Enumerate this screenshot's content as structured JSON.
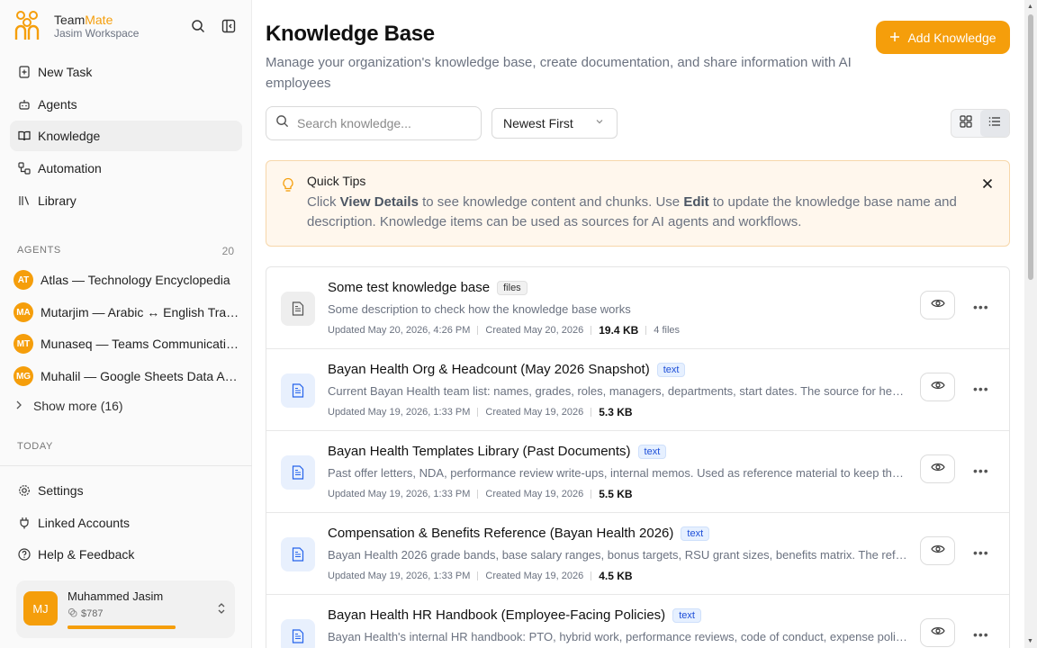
{
  "brand": {
    "name_part1": "Team",
    "name_part2": "Mate",
    "workspace": "Jasim Workspace"
  },
  "nav": [
    {
      "label": "New Task"
    },
    {
      "label": "Agents"
    },
    {
      "label": "Knowledge"
    },
    {
      "label": "Automation"
    },
    {
      "label": "Library"
    }
  ],
  "agents_section": {
    "label": "AGENTS",
    "count": "20"
  },
  "agents": [
    {
      "initials": "AT",
      "name": "Atlas — Technology Encyclopedia"
    },
    {
      "initials": "MA",
      "name": "Mutarjim — Arabic ↔ English Translator"
    },
    {
      "initials": "MT",
      "name": "Munaseq — Teams Communications"
    },
    {
      "initials": "MG",
      "name": "Muhalil — Google Sheets Data Analyst"
    }
  ],
  "show_more": "Show more (16)",
  "today_label": "TODAY",
  "bottom_nav": [
    {
      "label": "Settings"
    },
    {
      "label": "Linked Accounts"
    },
    {
      "label": "Help & Feedback"
    }
  ],
  "user": {
    "initials": "MJ",
    "name": "Muhammed Jasim",
    "credit": "$787",
    "credit_fraction": 1.0
  },
  "page": {
    "title": "Knowledge Base",
    "subtitle": "Manage your organization's knowledge base, create documentation, and share information with AI employees",
    "add_button": "Add Knowledge"
  },
  "search": {
    "placeholder": "Search knowledge..."
  },
  "sort": {
    "selected": "Newest First"
  },
  "tips": {
    "title": "Quick Tips",
    "part1": "Click ",
    "view_details": "View Details",
    "part2": " to see knowledge content and chunks. Use ",
    "edit": "Edit",
    "part3": " to update the knowledge base name and description. Knowledge items can be used as sources for AI agents and workflows."
  },
  "items": [
    {
      "title": "Some test knowledge base",
      "tag": "files",
      "description": "Some description to check how the knowledge base works",
      "updated": "Updated May 20, 2026, 4:26 PM",
      "created": "Created May 20, 2026",
      "size": "19.4 KB",
      "files": "4 files"
    },
    {
      "title": "Bayan Health Org & Headcount (May 2026 Snapshot)",
      "tag": "text",
      "description": "Current Bayan Health team list: names, grades, roles, managers, departments, start dates. The source for headcount questions.",
      "updated": "Updated May 19, 2026, 1:33 PM",
      "created": "Created May 19, 2026",
      "size": "5.3 KB",
      "files": ""
    },
    {
      "title": "Bayan Health Templates Library (Past Documents)",
      "tag": "text",
      "description": "Past offer letters, NDA, performance review write-ups, internal memos. Used as reference material to keep the tone consistent.",
      "updated": "Updated May 19, 2026, 1:33 PM",
      "created": "Created May 19, 2026",
      "size": "5.5 KB",
      "files": ""
    },
    {
      "title": "Compensation & Benefits Reference (Bayan Health 2026)",
      "tag": "text",
      "description": "Bayan Health 2026 grade bands, base salary ranges, bonus targets, RSU grant sizes, benefits matrix. The reference for comp questions.",
      "updated": "Updated May 19, 2026, 1:33 PM",
      "created": "Created May 19, 2026",
      "size": "4.5 KB",
      "files": ""
    },
    {
      "title": "Bayan Health HR Handbook (Employee-Facing Policies)",
      "tag": "text",
      "description": "Bayan Health's internal HR handbook: PTO, hybrid work, performance reviews, code of conduct, expense policy and more.",
      "updated": "",
      "created": "",
      "size": "",
      "files": ""
    }
  ]
}
